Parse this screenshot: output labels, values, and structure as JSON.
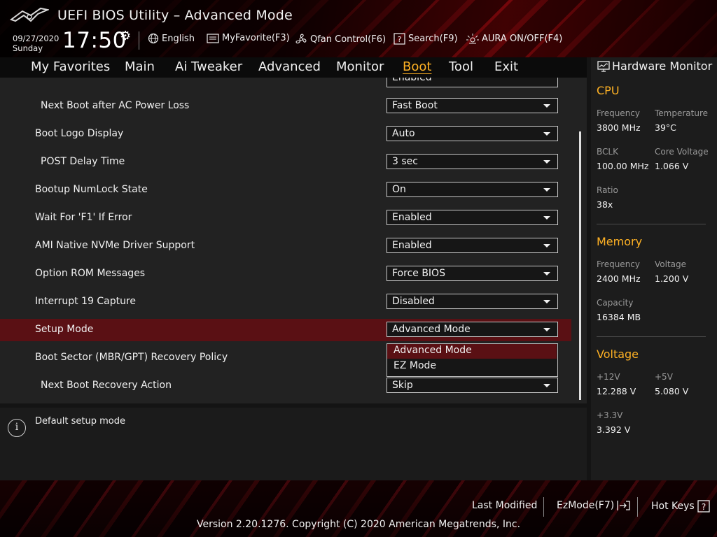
{
  "header": {
    "title": "UEFI BIOS Utility – Advanced Mode",
    "date": "09/27/2020",
    "day": "Sunday",
    "time": "17:50",
    "toolbar": [
      {
        "label": "English",
        "icon": "globe-icon"
      },
      {
        "label": "MyFavorite(F3)",
        "icon": "favorite-icon"
      },
      {
        "label": "Qfan Control(F6)",
        "icon": "fan-icon"
      },
      {
        "label": "Search(F9)",
        "icon": "search-help-icon"
      },
      {
        "label": "AURA ON/OFF(F4)",
        "icon": "aura-light-icon"
      }
    ]
  },
  "menu": {
    "items": [
      "My Favorites",
      "Main",
      "Ai Tweaker",
      "Advanced",
      "Monitor",
      "Boot",
      "Tool",
      "Exit"
    ],
    "active": "Boot"
  },
  "settings": {
    "partial_value": "Enabled",
    "rows": [
      {
        "label": "Next Boot after AC Power Loss",
        "value": "Fast Boot"
      },
      {
        "label": "Boot Logo Display",
        "value": "Auto"
      },
      {
        "label": "POST Delay Time",
        "value": "3 sec"
      },
      {
        "label": "Bootup NumLock State",
        "value": "On"
      },
      {
        "label": "Wait For 'F1' If Error",
        "value": "Enabled"
      },
      {
        "label": "AMI Native NVMe Driver Support",
        "value": "Enabled"
      },
      {
        "label": "Option ROM Messages",
        "value": "Force BIOS"
      },
      {
        "label": "Interrupt 19 Capture",
        "value": "Disabled"
      },
      {
        "label": "Setup Mode",
        "value": "Advanced Mode"
      },
      {
        "label": "Boot Sector (MBR/GPT) Recovery Policy",
        "value": ""
      },
      {
        "label": "Next Boot Recovery Action",
        "value": "Skip"
      }
    ],
    "dropdown_options": [
      "Advanced Mode",
      "EZ Mode"
    ],
    "dropdown_highlighted": "Advanced Mode"
  },
  "help": {
    "text": "Default setup mode"
  },
  "hardware_monitor": {
    "title": "Hardware Monitor",
    "cpu": {
      "title": "CPU",
      "frequency_label": "Frequency",
      "frequency": "3800 MHz",
      "temperature_label": "Temperature",
      "temperature": "39°C",
      "bclk_label": "BCLK",
      "bclk": "100.00 MHz",
      "core_voltage_label": "Core Voltage",
      "core_voltage": "1.066 V",
      "ratio_label": "Ratio",
      "ratio": "38x"
    },
    "memory": {
      "title": "Memory",
      "frequency_label": "Frequency",
      "frequency": "2400 MHz",
      "voltage_label": "Voltage",
      "voltage": "1.200 V",
      "capacity_label": "Capacity",
      "capacity": "16384 MB"
    },
    "voltage": {
      "title": "Voltage",
      "v12_label": "+12V",
      "v12": "12.288 V",
      "v5_label": "+5V",
      "v5": "5.080 V",
      "v33_label": "+3.3V",
      "v33": "3.392 V"
    }
  },
  "footer": {
    "last_modified": "Last Modified",
    "ezmode": "EzMode(F7)",
    "hot_keys": "Hot Keys",
    "version": "Version 2.20.1276. Copyright (C) 2020 American Megatrends, Inc."
  },
  "colors": {
    "accent": "#ffb224",
    "selection": "#5a1014",
    "panel": "#222222"
  }
}
